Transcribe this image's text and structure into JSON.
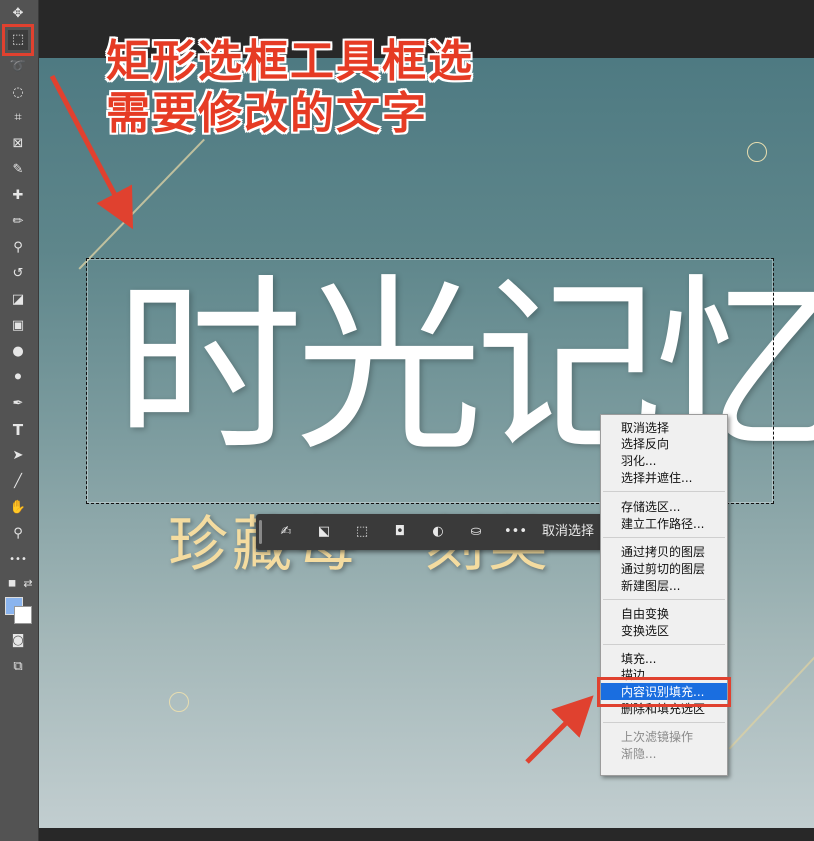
{
  "toolbar": {
    "tools": [
      {
        "name": "move-tool",
        "glyph": "✥"
      },
      {
        "name": "rectangular-marquee-tool",
        "glyph": "⬚"
      },
      {
        "name": "lasso-tool",
        "glyph": "➰"
      },
      {
        "name": "object-selection-tool",
        "glyph": "◌"
      },
      {
        "name": "crop-tool",
        "glyph": "⌗"
      },
      {
        "name": "frame-tool",
        "glyph": "⊠"
      },
      {
        "name": "eyedropper-tool",
        "glyph": "✎"
      },
      {
        "name": "healing-brush-tool",
        "glyph": "✚"
      },
      {
        "name": "brush-tool",
        "glyph": "✏"
      },
      {
        "name": "clone-stamp-tool",
        "glyph": "⚲"
      },
      {
        "name": "history-brush-tool",
        "glyph": "↺"
      },
      {
        "name": "eraser-tool",
        "glyph": "◪"
      },
      {
        "name": "gradient-tool",
        "glyph": "▣"
      },
      {
        "name": "blur-tool",
        "glyph": "●"
      },
      {
        "name": "dodge-tool",
        "glyph": "⚫"
      },
      {
        "name": "pen-tool",
        "glyph": "✒"
      },
      {
        "name": "type-tool",
        "glyph": "T"
      },
      {
        "name": "path-selection-tool",
        "glyph": "➤"
      },
      {
        "name": "line-tool",
        "glyph": "╱"
      },
      {
        "name": "hand-tool",
        "glyph": "✋"
      },
      {
        "name": "zoom-tool",
        "glyph": "⚲"
      },
      {
        "name": "more-tools",
        "glyph": "•••"
      }
    ],
    "active_tool": "rectangular-marquee-tool",
    "foreground_color": "#8ab4ee",
    "background_color": "#ffffff"
  },
  "annotation": {
    "line1": "矩形选框工具框选",
    "line2": "需要修改的文字",
    "color": "#e63b24"
  },
  "canvas": {
    "main_title": "时光记忆",
    "sub_title": "珍藏每一刻美"
  },
  "task_bar": {
    "icons": [
      "brush-icon",
      "select-subject-icon",
      "transform-selection-icon",
      "mask-icon",
      "adjustment-icon",
      "fill-icon",
      "more-icon"
    ],
    "deselect_label": "取消选择"
  },
  "context_menu": {
    "items": [
      {
        "label": "取消选择",
        "enabled": true
      },
      {
        "label": "选择反向",
        "enabled": true
      },
      {
        "label": "羽化...",
        "enabled": true
      },
      {
        "label": "选择并遮住...",
        "enabled": true
      },
      {
        "label": "存储选区...",
        "enabled": true
      },
      {
        "label": "建立工作路径...",
        "enabled": true
      },
      {
        "label": "通过拷贝的图层",
        "enabled": true
      },
      {
        "label": "通过剪切的图层",
        "enabled": true
      },
      {
        "label": "新建图层...",
        "enabled": true
      },
      {
        "label": "自由变换",
        "enabled": true
      },
      {
        "label": "变换选区",
        "enabled": true
      },
      {
        "label": "填充...",
        "enabled": true
      },
      {
        "label": "描边...",
        "enabled": true
      },
      {
        "label": "内容识别填充...",
        "enabled": true,
        "highlighted": true
      },
      {
        "label": "删除和填充选区",
        "enabled": true
      },
      {
        "label": "上次滤镜操作",
        "enabled": false
      },
      {
        "label": "渐隐...",
        "enabled": false
      }
    ]
  }
}
